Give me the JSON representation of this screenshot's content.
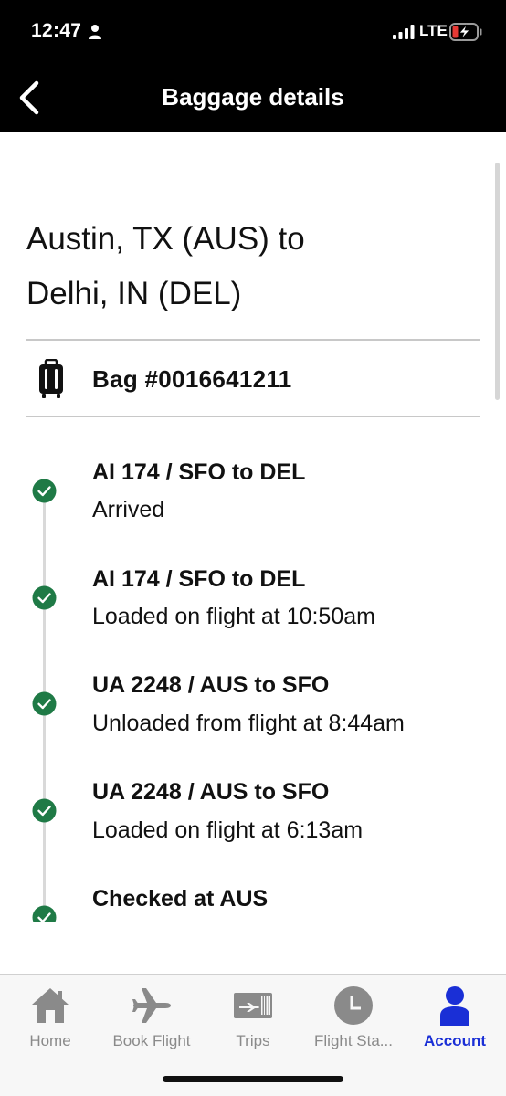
{
  "status_bar": {
    "time": "12:47",
    "network": "LTE",
    "icons": [
      "person-icon",
      "signal-bars-icon",
      "battery-charging-icon"
    ]
  },
  "header": {
    "title": "Baggage details",
    "back_icon": "chevron-left-icon"
  },
  "route": {
    "title_line1": "Austin, TX (AUS) to",
    "title_line2": "Delhi, IN (DEL)"
  },
  "bag": {
    "icon": "luggage-icon",
    "label": "Bag #0016641211"
  },
  "timeline": [
    {
      "title": "AI 174 / SFO to DEL",
      "status": "Arrived"
    },
    {
      "title": "AI 174 / SFO to DEL",
      "status": "Loaded on flight at 10:50am"
    },
    {
      "title": "UA 2248 / AUS to SFO",
      "status": "Unloaded from flight at 8:44am"
    },
    {
      "title": "UA 2248 / AUS to SFO",
      "status": "Loaded on flight at 6:13am"
    },
    {
      "title": "Checked at AUS",
      "status": ""
    }
  ],
  "tabs": [
    {
      "label": "Home",
      "icon": "home-icon",
      "active": false
    },
    {
      "label": "Book Flight",
      "icon": "airplane-icon",
      "active": false
    },
    {
      "label": "Trips",
      "icon": "ticket-icon",
      "active": false
    },
    {
      "label": "Flight Sta...",
      "icon": "clock-icon",
      "active": false
    },
    {
      "label": "Account",
      "icon": "account-icon",
      "active": true
    }
  ],
  "colors": {
    "header_bg": "#000000",
    "check_green": "#1f7a46",
    "active_tab": "#1a2fd6",
    "inactive_tab": "#8a8a8a"
  }
}
